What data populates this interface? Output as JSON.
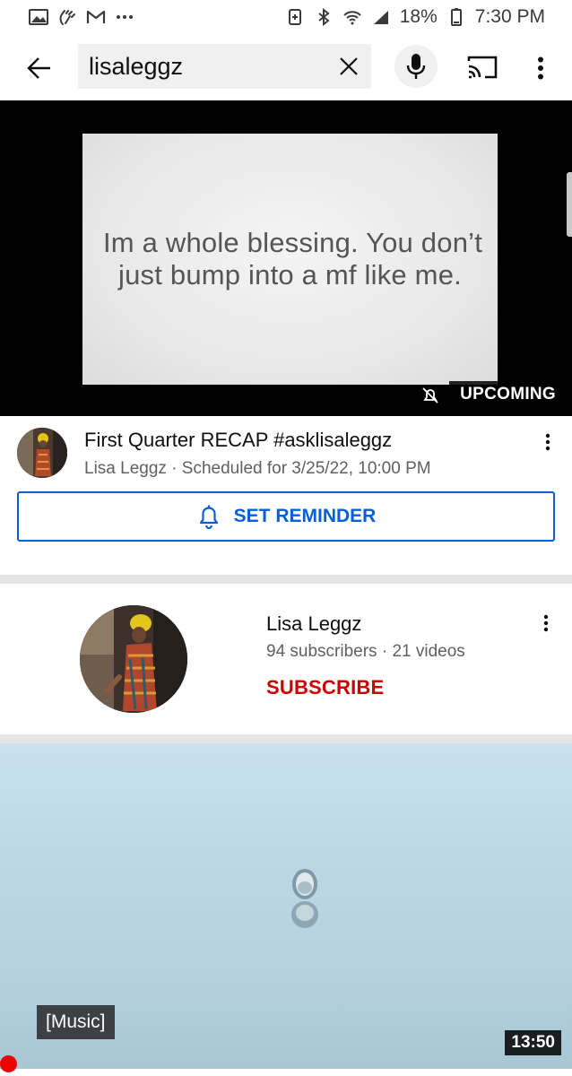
{
  "status_bar": {
    "battery": "18%",
    "time": "7:30 PM",
    "left_icons": [
      "gallery-icon",
      "wave-hand-icon",
      "gmail-icon",
      "more-dots-icon"
    ],
    "right_icons": [
      "battery-saver-icon",
      "bluetooth-icon",
      "wifi-icon",
      "signal-icon",
      "battery-icon"
    ]
  },
  "search": {
    "query": "lisaleggz"
  },
  "header_icons": [
    "back-arrow-icon",
    "clear-icon",
    "mic-icon",
    "cast-icon",
    "more-vert-icon"
  ],
  "upcoming_video": {
    "thumbnail_text_line1": "Im a whole blessing. You don’t",
    "thumbnail_text_line2": "just bump into a mf like me.",
    "badge": "UPCOMING",
    "title": "First Quarter RECAP #asklisaleggz",
    "subtitle": "Lisa Leggz · Scheduled for 3/25/22, 10:00 PM",
    "reminder_label": "SET REMINDER"
  },
  "channel": {
    "name": "Lisa Leggz",
    "stats": "94 subscribers · 21 videos",
    "subscribe_label": "SUBSCRIBE"
  },
  "video2": {
    "caption": "[Music]",
    "duration": "13:50"
  },
  "colors": {
    "accent_blue": "#065fd4",
    "subscribe_red": "#cc0000",
    "progress_red": "#ee0000"
  }
}
